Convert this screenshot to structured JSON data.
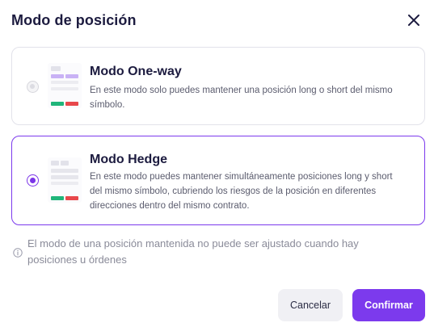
{
  "dialog": {
    "title": "Modo de posición",
    "close_icon": "close-icon"
  },
  "options": [
    {
      "id": "oneway",
      "title": "Modo One-way",
      "description": "En este modo solo puedes mantener una posición long o short del mismo símbolo.",
      "selected": false
    },
    {
      "id": "hedge",
      "title": "Modo Hedge",
      "description": "En este modo puedes mantener simultáneamente posiciones long y short del mismo símbolo, cubriendo los riesgos de la posición en diferentes direcciones dentro del mismo contrato.",
      "selected": true
    }
  ],
  "notice": {
    "icon": "info-icon",
    "text": "El modo de una posición mantenida no puede ser ajustado cuando hay posiciones u órdenes"
  },
  "buttons": {
    "cancel": "Cancelar",
    "confirm": "Confirmar"
  },
  "colors": {
    "accent": "#7c3aed",
    "long": "#1fb57a",
    "short": "#e8474b",
    "highlight_row": "#c9b2f5"
  }
}
